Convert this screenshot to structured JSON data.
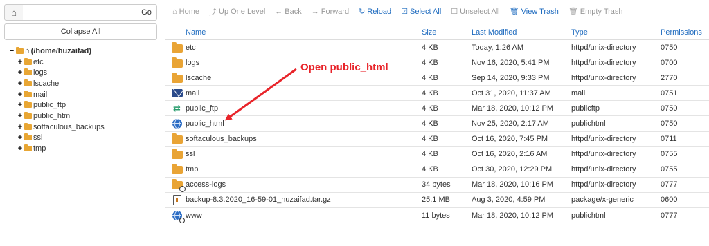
{
  "left_panel": {
    "path_value": "",
    "go_label": "Go",
    "collapse_label": "Collapse All",
    "tree_root": "(/home/huzaifad)",
    "tree_items": [
      "etc",
      "logs",
      "lscache",
      "mail",
      "public_ftp",
      "public_html",
      "softaculous_backups",
      "ssl",
      "tmp"
    ]
  },
  "toolbar": {
    "home": "Home",
    "up_one_level": "Up One Level",
    "back": "Back",
    "forward": "Forward",
    "reload": "Reload",
    "select_all": "Select All",
    "unselect_all": "Unselect All",
    "view_trash": "View Trash",
    "empty_trash": "Empty Trash"
  },
  "table": {
    "headers": {
      "name": "Name",
      "size": "Size",
      "modified": "Last Modified",
      "type": "Type",
      "permissions": "Permissions"
    },
    "rows": [
      {
        "name": "etc",
        "size": "4 KB",
        "modified": "Today, 1:26 AM",
        "type": "httpd/unix-directory",
        "perm": "0750"
      },
      {
        "name": "logs",
        "size": "4 KB",
        "modified": "Nov 16, 2020, 5:41 PM",
        "type": "httpd/unix-directory",
        "perm": "0700"
      },
      {
        "name": "lscache",
        "size": "4 KB",
        "modified": "Sep 14, 2020, 9:33 PM",
        "type": "httpd/unix-directory",
        "perm": "2770"
      },
      {
        "name": "mail",
        "size": "4 KB",
        "modified": "Oct 31, 2020, 11:37 AM",
        "type": "mail",
        "perm": "0751"
      },
      {
        "name": "public_ftp",
        "size": "4 KB",
        "modified": "Mar 18, 2020, 10:12 PM",
        "type": "publicftp",
        "perm": "0750"
      },
      {
        "name": "public_html",
        "size": "4 KB",
        "modified": "Nov 25, 2020, 2:17 AM",
        "type": "publichtml",
        "perm": "0750"
      },
      {
        "name": "softaculous_backups",
        "size": "4 KB",
        "modified": "Oct 16, 2020, 7:45 PM",
        "type": "httpd/unix-directory",
        "perm": "0711"
      },
      {
        "name": "ssl",
        "size": "4 KB",
        "modified": "Oct 16, 2020, 2:16 AM",
        "type": "httpd/unix-directory",
        "perm": "0755"
      },
      {
        "name": "tmp",
        "size": "4 KB",
        "modified": "Oct 30, 2020, 12:29 PM",
        "type": "httpd/unix-directory",
        "perm": "0755"
      },
      {
        "name": "access-logs",
        "size": "34 bytes",
        "modified": "Mar 18, 2020, 10:16 PM",
        "type": "httpd/unix-directory",
        "perm": "0777"
      },
      {
        "name": "backup-8.3.2020_16-59-01_huzaifad.tar.gz",
        "size": "25.1 MB",
        "modified": "Aug 3, 2020, 4:59 PM",
        "type": "package/x-generic",
        "perm": "0600"
      },
      {
        "name": "www",
        "size": "11 bytes",
        "modified": "Mar 18, 2020, 10:12 PM",
        "type": "publichtml",
        "perm": "0777"
      }
    ]
  },
  "annotation": {
    "text": "Open public_html"
  },
  "colors": {
    "accent": "#1e6bbf",
    "folder": "#e9a435",
    "annotation": "#e8242a"
  }
}
